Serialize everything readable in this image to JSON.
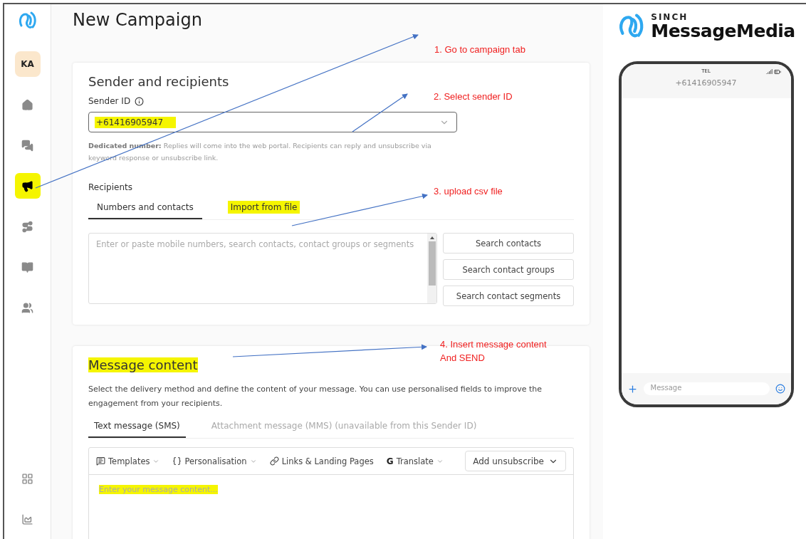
{
  "sidebar": {
    "avatar": "KA",
    "items": [
      {
        "kind": "home",
        "selected": false,
        "highlighted": false
      },
      {
        "kind": "chat",
        "selected": false,
        "highlighted": false
      },
      {
        "kind": "campaign",
        "selected": true,
        "highlighted": true
      },
      {
        "kind": "route",
        "selected": false,
        "highlighted": false
      },
      {
        "kind": "book",
        "selected": false,
        "highlighted": false
      },
      {
        "kind": "people",
        "selected": false,
        "highlighted": false
      }
    ],
    "bottom_items": [
      {
        "kind": "apps",
        "selected": false
      },
      {
        "kind": "reports",
        "selected": false
      }
    ]
  },
  "page": {
    "title": "New Campaign"
  },
  "sender_card": {
    "title": "Sender and recipients",
    "sender_label": "Sender ID",
    "sender_value": "+61416905947",
    "sender_highlighted": true,
    "note_bold": "Dedicated number:",
    "note": "Replies will come into the web portal. Recipients can reply and unsubscribe via keyword response or unsubscribe link.",
    "recipients_label": "Recipients",
    "tabs": [
      {
        "label": "Numbers and contacts",
        "selected": true,
        "highlighted": false
      },
      {
        "label": "Import from file",
        "selected": false,
        "highlighted": true
      }
    ],
    "recipients_placeholder": "Enter or paste mobile numbers, search contacts, contact groups or segments",
    "buttons": [
      "Search contacts",
      "Search contact groups",
      "Search contact segments"
    ]
  },
  "message_card": {
    "title": "Message content",
    "title_highlighted": true,
    "description": "Select the delivery method and define the content of your message. You can use personalised fields to improve the engagement from your recipients.",
    "tabs": [
      {
        "label": "Text message (SMS)",
        "selected": true,
        "disabled": false
      },
      {
        "label": "Attachment message (MMS) (unavailable from this Sender ID)",
        "selected": false,
        "disabled": true
      }
    ],
    "toolbar": [
      {
        "kind": "templates",
        "label": "Templates",
        "dropdown": true
      },
      {
        "kind": "personalisation",
        "label": "Personalisation",
        "dropdown": true
      },
      {
        "kind": "links",
        "label": "Links & Landing Pages",
        "dropdown": false
      },
      {
        "kind": "translate",
        "glyph": "G",
        "label": "Translate",
        "dropdown": true
      }
    ],
    "unsubscribe_button": "Add unsubscribe",
    "placeholder": "Enter your message content...",
    "placeholder_highlighted": true
  },
  "brand": {
    "top": "SINCH",
    "name": "MessageMedia"
  },
  "phone": {
    "carrier": "TEL",
    "number": "+61416905947",
    "input_placeholder": "Message"
  },
  "annotations": [
    {
      "text": "1.   Go to campaign tab"
    },
    {
      "text": "2. Select sender ID"
    },
    {
      "text": "3. upload csv file"
    },
    {
      "text": "4. Insert message content\nAnd SEND"
    }
  ]
}
